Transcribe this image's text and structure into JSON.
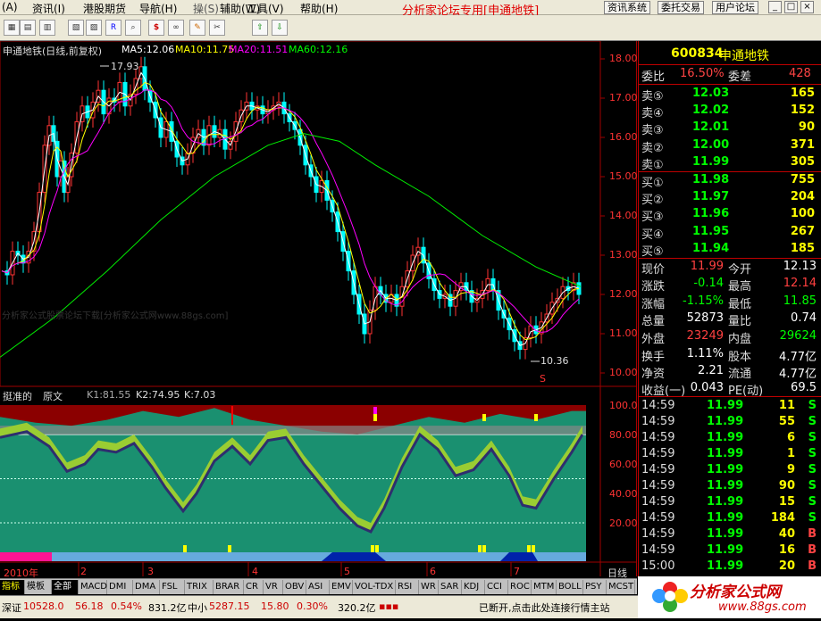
{
  "menu": {
    "items": [
      "(A)",
      "资讯(I)",
      "港股期货",
      "导航(H)",
      "操(S)",
      "辅助(W)",
      "工具(V)",
      "帮助(H)"
    ],
    "promo": "分析家论坛专用[申通地铁]",
    "right_buttons": [
      "资讯系统",
      "委托交易",
      "用户论坛"
    ],
    "window_buttons": [
      "_",
      "□",
      "×"
    ]
  },
  "toolbar": {
    "icons": [
      "grid-icon",
      "grid2-icon",
      "chart-icon",
      "chart2-icon",
      "chart3-icon",
      "rsi-icon",
      "search-icon",
      "dollar-icon",
      "link-icon",
      "pen-icon",
      "tools-icon",
      "up-arrow-icon",
      "down-arrow-icon"
    ]
  },
  "main_chart": {
    "title": "申通地铁(日线,前复权)",
    "ma5": "MA5:12.06",
    "ma10": "MA10:11.75",
    "ma20": "MA20:11.51",
    "ma60": "MA60:12.16",
    "high_label": "17.93",
    "low_label": "10.36",
    "marker": "S",
    "y_ticks": [
      "18.00",
      "17.00",
      "16.00",
      "15.00",
      "14.00",
      "13.00",
      "12.00",
      "11.00",
      "10.00"
    ],
    "watermark": "分析家公式股票论坛下载[分析家公式网www.88gs.com]",
    "colors": {
      "ma5": "#ffffff",
      "ma10": "#ffff00",
      "ma20": "#ff00ff",
      "ma60": "#00ff00",
      "up": "#ff3333",
      "down": "#00ffff"
    }
  },
  "indicator": {
    "name": "挺准的",
    "source": "原文",
    "k1": "K1:81.55",
    "k2": "K2:74.95",
    "k": "K:7.03",
    "y_ticks": [
      "100.00",
      "80.00",
      "60.00",
      "40.00",
      "20.00"
    ]
  },
  "x_axis": {
    "labels": [
      "2010年",
      "2",
      "3",
      "4",
      "5",
      "6",
      "7"
    ],
    "period": "日线"
  },
  "tabs": [
    "指标",
    "模板",
    "全部",
    "MACD",
    "DMI",
    "DMA",
    "FSL",
    "TRIX",
    "BRAR",
    "CR",
    "VR",
    "OBV",
    "ASI",
    "EMV",
    "VOL-TDX",
    "RSI",
    "WR",
    "SAR",
    "KDJ",
    "CCI",
    "ROC",
    "MTM",
    "BOLL",
    "PSY",
    "MCST"
  ],
  "quote": {
    "code": "600834",
    "name": "申通地铁",
    "webi_label": "委比",
    "webi": "16.50%",
    "weicha_label": "委差",
    "weicha": "428",
    "asks": [
      {
        "label": "卖⑤",
        "price": "12.03",
        "vol": "165"
      },
      {
        "label": "卖④",
        "price": "12.02",
        "vol": "152"
      },
      {
        "label": "卖③",
        "price": "12.01",
        "vol": "90"
      },
      {
        "label": "卖②",
        "price": "12.00",
        "vol": "371"
      },
      {
        "label": "卖①",
        "price": "11.99",
        "vol": "305"
      }
    ],
    "bids": [
      {
        "label": "买①",
        "price": "11.98",
        "vol": "755"
      },
      {
        "label": "买②",
        "price": "11.97",
        "vol": "204"
      },
      {
        "label": "买③",
        "price": "11.96",
        "vol": "100"
      },
      {
        "label": "买④",
        "price": "11.95",
        "vol": "267"
      },
      {
        "label": "买⑤",
        "price": "11.94",
        "vol": "185"
      }
    ],
    "stats": [
      {
        "l1": "现价",
        "v1": "11.99",
        "l2": "今开",
        "v2": "12.13",
        "c1": "#ff4040",
        "c2": "#ffffff"
      },
      {
        "l1": "涨跌",
        "v1": "-0.14",
        "l2": "最高",
        "v2": "12.14",
        "c1": "#00ff00",
        "c2": "#ff4040"
      },
      {
        "l1": "涨幅",
        "v1": "-1.15%",
        "l2": "最低",
        "v2": "11.85",
        "c1": "#00ff00",
        "c2": "#00ff00"
      },
      {
        "l1": "总量",
        "v1": "52873",
        "l2": "量比",
        "v2": "0.74",
        "c1": "#ffffff",
        "c2": "#ffffff"
      },
      {
        "l1": "外盘",
        "v1": "23249",
        "l2": "内盘",
        "v2": "29624",
        "c1": "#ff4040",
        "c2": "#00ff00"
      },
      {
        "l1": "换手",
        "v1": "1.11%",
        "l2": "股本",
        "v2": "4.77亿",
        "c1": "#ffffff",
        "c2": "#ffffff"
      },
      {
        "l1": "净资",
        "v1": "2.21",
        "l2": "流通",
        "v2": "4.77亿",
        "c1": "#ffffff",
        "c2": "#ffffff"
      },
      {
        "l1": "收益(一)",
        "v1": "0.043",
        "l2": "PE(动)",
        "v2": "69.5",
        "c1": "#ffffff",
        "c2": "#ffffff"
      }
    ],
    "ticks": [
      {
        "time": "14:59",
        "price": "11.99",
        "vol": "11",
        "side": "S"
      },
      {
        "time": "14:59",
        "price": "11.99",
        "vol": "55",
        "side": "S"
      },
      {
        "time": "14:59",
        "price": "11.99",
        "vol": "6",
        "side": "S"
      },
      {
        "time": "14:59",
        "price": "11.99",
        "vol": "1",
        "side": "S"
      },
      {
        "time": "14:59",
        "price": "11.99",
        "vol": "9",
        "side": "S"
      },
      {
        "time": "14:59",
        "price": "11.99",
        "vol": "90",
        "side": "S"
      },
      {
        "time": "14:59",
        "price": "11.99",
        "vol": "15",
        "side": "S"
      },
      {
        "time": "14:59",
        "price": "11.99",
        "vol": "184",
        "side": "S"
      },
      {
        "time": "14:59",
        "price": "11.99",
        "vol": "40",
        "side": "B"
      },
      {
        "time": "14:59",
        "price": "11.99",
        "vol": "16",
        "side": "B"
      },
      {
        "time": "15:00",
        "price": "11.99",
        "vol": "20",
        "side": "B"
      }
    ]
  },
  "status": {
    "sz_label": "深证",
    "sz_val": "10528.0",
    "sz_chg": "56.18",
    "sz_pct": "0.54%",
    "sz_amt": "831.2亿",
    "zx_label": "中小",
    "zx_val": "5287.15",
    "zx_chg": "15.80",
    "zx_pct": "0.30%",
    "zx_amt": "320.2亿",
    "msg": "已断开,点击此处连接行情主站"
  },
  "logo": {
    "text": "分析家公式网",
    "url": "www.88gs.com"
  }
}
